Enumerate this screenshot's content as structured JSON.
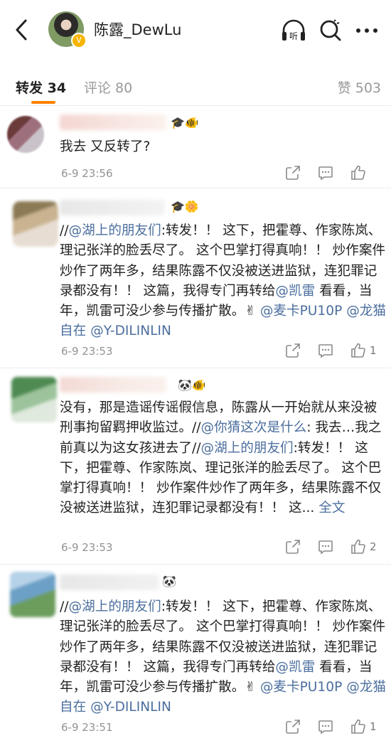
{
  "header": {
    "title": "陈露_DewLu",
    "listen_label": "听"
  },
  "tabs": {
    "repost": "转发 34",
    "comment": "评论 80",
    "like": "赞 503"
  },
  "reposts": [
    {
      "time": "6-9 23:56",
      "like_count": "",
      "badges": "🎓🐠",
      "segments": [
        {
          "text": "我去 又反转了?"
        }
      ]
    },
    {
      "time": "6-9 23:53",
      "like_count": "1",
      "badges": "🎓🌼",
      "segments": [
        {
          "text": "//",
          "link": false
        },
        {
          "text": "@湖上的朋友们",
          "link": true
        },
        {
          "text": ":转发！！ 这下，把霍尊、作家陈岚、理记张洋的脸丢尽了。 这个巴掌打得真响！！ 炒作案件炒作了两年多，结果陈露不仅没被送进监狱，连犯罪记录都没有！！ 这篇，我得专门再转给",
          "link": false
        },
        {
          "text": "@凯雷",
          "link": true
        },
        {
          "text": " 看看，当年，凯雷可没少参与传播扩散。✌ ",
          "link": false
        },
        {
          "text": "@麦卡PU10P",
          "link": true
        },
        {
          "text": " ",
          "link": false
        },
        {
          "text": "@龙猫自在",
          "link": true
        },
        {
          "text": " ",
          "link": false
        },
        {
          "text": "@Y-DILINLIN",
          "link": true
        }
      ]
    },
    {
      "time": "6-9 23:53",
      "like_count": "2",
      "badges": "🐼🐠",
      "segments": [
        {
          "text": "没有，那是造谣传谣假信息，陈露从一开始就从来没被刑事拘留羁押收监过。//",
          "link": false
        },
        {
          "text": "@你猜这次是什么",
          "link": true
        },
        {
          "text": ": 我去…我之前真以为这女孩进去了//",
          "link": false
        },
        {
          "text": "@湖上的朋友们",
          "link": true
        },
        {
          "text": ":转发！！ 这下，把霍尊、作家陈岚、理记张洋的脸丢尽了。 这个巴掌打得真响！！ 炒作案件炒作了两年多，结果陈露不仅没被送进监狱，连犯罪记录都没有！！ 这... ",
          "link": false
        },
        {
          "text": "全文",
          "link": true
        }
      ]
    },
    {
      "time": "6-9 23:51",
      "like_count": "1",
      "badges": "🐼",
      "segments": [
        {
          "text": "//",
          "link": false
        },
        {
          "text": "@湖上的朋友们",
          "link": true
        },
        {
          "text": ":转发！！ 这下，把霍尊、作家陈岚、理记张洋的脸丢尽了。 这个巴掌打得真响！！ 炒作案件炒作了两年多，结果陈露不仅没被送进监狱，连犯罪记录都没有！！ 这篇，我得专门再转给",
          "link": false
        },
        {
          "text": "@凯雷",
          "link": true
        },
        {
          "text": " 看看，当年，凯雷可没少参与传播扩散。✌ ",
          "link": false
        },
        {
          "text": "@麦卡PU10P",
          "link": true
        },
        {
          "text": " ",
          "link": false
        },
        {
          "text": "@龙猫自在",
          "link": true
        },
        {
          "text": " ",
          "link": false
        },
        {
          "text": "@Y-DILINLIN",
          "link": true
        }
      ]
    }
  ],
  "colors": {
    "accent": "#ff8200",
    "link": "#4b6e9e",
    "muted": "#939393",
    "vip_badge": "#f7b500"
  },
  "icons": [
    "back-arrow-icon",
    "listen-icon",
    "search-icon",
    "more-icon",
    "share-icon",
    "comment-icon",
    "like-icon"
  ]
}
